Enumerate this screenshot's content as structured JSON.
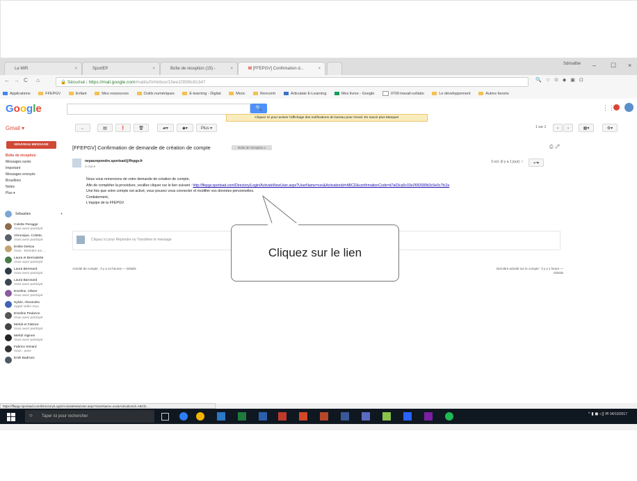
{
  "browser": {
    "tabs": [
      {
        "label": "Le MIR"
      },
      {
        "label": "SportEP"
      },
      {
        "label": "Boîte de réception (15) -"
      },
      {
        "label": "[FFEPGV] Confirmation d..."
      }
    ],
    "profile": "Sdmailbe",
    "secure_label": "Sécurisé",
    "url_host": "https://mail.google.com",
    "url_path": "/mail/u/0/#inbox/15ee1f35f8c81347",
    "bookmarks": [
      "Applications",
      "FFEPGV",
      "Enfant",
      "Mes ressources",
      "Outils numériques",
      "E-learning - Digital",
      "Mooc",
      "Rencontr",
      "Articulate E-Learning",
      "Mes livres - Google",
      "0700-travail-collabo",
      "Le développement",
      "Autres favoris"
    ]
  },
  "gmail": {
    "logo": "Google",
    "search_button": "🔍",
    "banner": "Cliquez ici pour activer l'affichage des notifications de bureau pour Gmail.  En savoir plus  Masquer",
    "gmail_label": "Gmail ▾",
    "compose": "NOUVEAU MESSAGE",
    "more_button": "Plus ▾",
    "pager": "1 sur 1",
    "nav": [
      "Boîte de réception",
      "Messages suivis",
      "Important",
      "Messages envoyés",
      "Brouillons",
      "Notes",
      "Plus ▾"
    ],
    "hangouts_label": "Sébastien",
    "contacts": [
      {
        "name": "Colette Peragge",
        "status": "Vous avez participé"
      },
      {
        "name": "Véronique, Colette,",
        "status": "Vous avez participé"
      },
      {
        "name": "Emilie Delsou",
        "status": "Vous : Eteindre sur ..."
      },
      {
        "name": "Laura et Bernadette",
        "status": "Vous avez participé"
      },
      {
        "name": "Laura Berenard",
        "status": "Vous avez participé"
      },
      {
        "name": "Laura Baronard",
        "status": "Vous avez participé"
      },
      {
        "name": "Emeline, Olivier",
        "status": "Vous avez participé"
      },
      {
        "name": "Sylvie, Alexandra",
        "status": "Appel vidéo reçu"
      },
      {
        "name": "Emeline Pedance",
        "status": "Vous avez participé"
      },
      {
        "name": "Mehdi et Fabrice",
        "status": "Vous avez participé"
      },
      {
        "name": "Mehdi Viginen",
        "status": "Vous avez participé"
      },
      {
        "name": "Fabrice Simard",
        "status": "Vous : avez"
      },
      {
        "name": "Emili Badrnes",
        "status": ""
      }
    ],
    "subject": "[FFEPGV] Confirmation de demande de création de compte",
    "label_chip": "Boîte de réception x",
    "sender": "nepasrepondre.sportsad@ffepgv.fr",
    "to_me": "À moi ▾",
    "date": "3 oct. (il y a 1 jour) ☆",
    "body_lines": [
      "Nous vous remercions de votre demande de création de compte.",
      "Afin de compléter la procédure, veuillez cliquer sur le lien suivant : ",
      "Une fois que votre compte est activé, vous pouvez vous connecter et modifier vos données personnelles.",
      "Cordialement,",
      "L'équipe de la FFEPGV"
    ],
    "link": "http://ffepgv.sportsad.com/Directory/Login/ActivateNewUser.aspx?UserName=xxx&ActivationId=ABCD&confirmationCode=d7a03ca5c03e2f0f2689b3c5e0c7fc2a",
    "reply_placeholder": "Cliquez ici pour Répondre ou Transférer le message",
    "footer_left": "Activité de compte : il y a 14 heures — Détails",
    "footer_right": "Dernière activité sur le compte : il y a 1 heure — Détails"
  },
  "status_url": "https://ffepgv.sportsad.com/Directory/Login/ActivateNewUser.aspx?UserName=xxx&ActivationId=ABCD...",
  "taskbar": {
    "search_placeholder": "Taper ici pour rechercher",
    "date": "04/10/2017"
  },
  "callout": {
    "text": "Cliquez sur le lien"
  }
}
